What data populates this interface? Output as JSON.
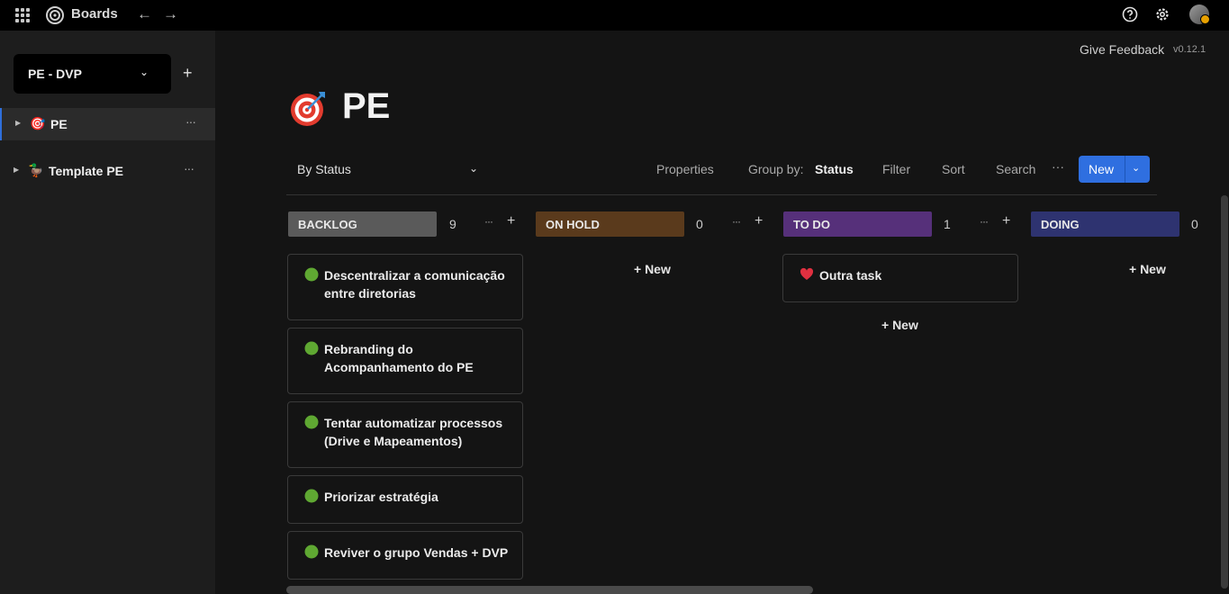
{
  "topbar": {
    "app_title": "Boards",
    "icons": [
      "apps-grid-icon",
      "boards-logo-icon",
      "arrow-left-icon",
      "arrow-right-icon",
      "help-icon",
      "gear-icon",
      "avatar"
    ]
  },
  "sidebar": {
    "workspace": "PE - DVP",
    "add_label": "+",
    "boards": [
      {
        "emoji": "🎯",
        "label": "PE",
        "active": true
      },
      {
        "emoji": "🦆",
        "label": "Template PE",
        "active": false
      }
    ],
    "more_label": "···"
  },
  "main": {
    "feedback": "Give Feedback",
    "version": "v0.12.1",
    "page_emoji": "target-icon",
    "title": "PE",
    "view": "By Status",
    "toolbar": {
      "properties": "Properties",
      "group_by": "Group by:",
      "group_by_value": "Status",
      "filter": "Filter",
      "sort": "Sort",
      "search": "Search",
      "more": "···",
      "new": "New"
    },
    "columns": [
      {
        "name": "BACKLOG",
        "count": "9",
        "color": "#5a5a5a"
      },
      {
        "name": "ON HOLD",
        "count": "0",
        "color": "#5a3a1c"
      },
      {
        "name": "TO DO",
        "count": "1",
        "color": "#56307a"
      },
      {
        "name": "DOING",
        "count": "0",
        "color": "#2e3370"
      }
    ],
    "backlog_cards": [
      {
        "icon": "green-circle-icon",
        "title": "Descentralizar a comunicação entre diretorias"
      },
      {
        "icon": "green-circle-icon",
        "title": "Rebranding do Acompanhamento do PE"
      },
      {
        "icon": "green-circle-icon",
        "title": "Tentar automatizar processos (Drive e Mapeamentos)"
      },
      {
        "icon": "green-circle-icon",
        "title": "Priorizar estratégia"
      },
      {
        "icon": "green-circle-icon",
        "title": "Reviver o grupo Vendas + DVP"
      }
    ],
    "todo_cards": [
      {
        "icon": "heart-icon",
        "title": "Outra task"
      }
    ],
    "add_new": "+ New",
    "col_more": "···",
    "col_add": "+"
  }
}
